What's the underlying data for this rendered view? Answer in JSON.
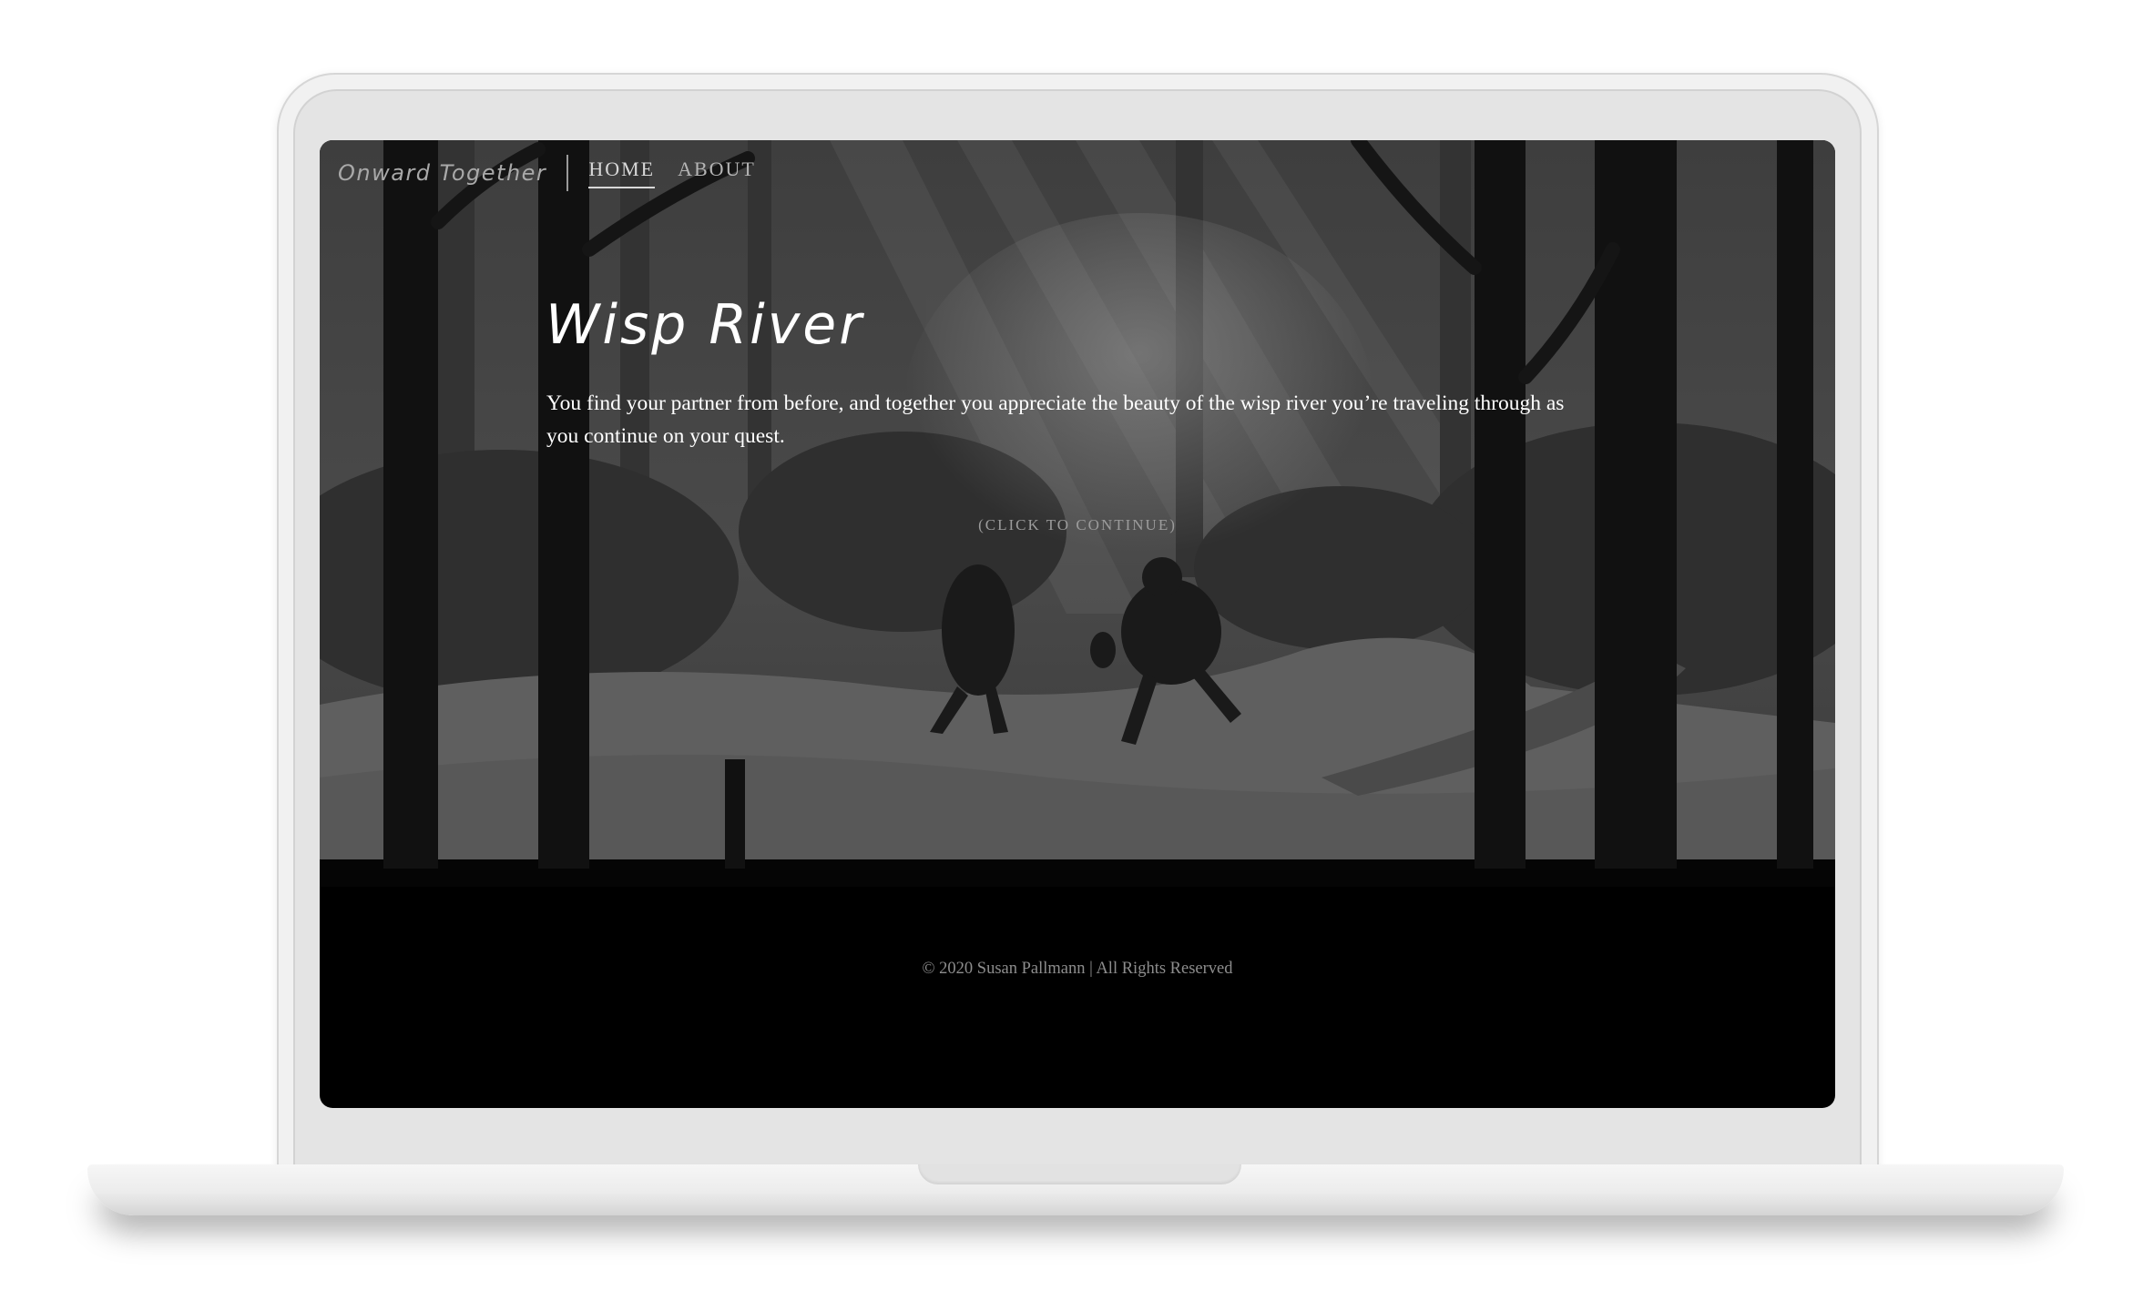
{
  "site": {
    "brand": "Onward Together",
    "nav": [
      {
        "label": "HOME",
        "active": true
      },
      {
        "label": "ABOUT",
        "active": false
      }
    ]
  },
  "hero": {
    "title": "Wisp River",
    "description": "You find your partner from before, and together you appreciate the beauty of the wisp river you’re traveling through as you continue on your quest.",
    "continue_label": "(CLICK TO CONTINUE)",
    "illustration_icon": "forest-travelers-illustration"
  },
  "footer": {
    "copyright": "© 2020 Susan Pallmann | All Rights Reserved"
  },
  "colors": {
    "page_bg": "#000000",
    "text": "#ffffff",
    "muted_text": "#8d8d8d",
    "device_frame": "#e4e4e4"
  }
}
